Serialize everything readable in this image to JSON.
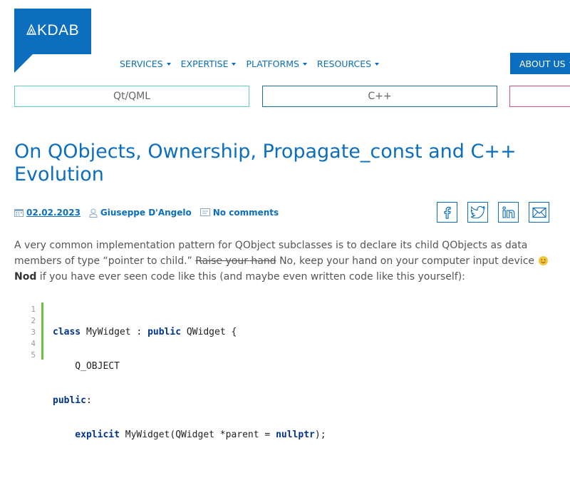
{
  "logo": {
    "text": "KDAB",
    "brand_color": "#0b6ebf"
  },
  "nav": {
    "items": [
      {
        "label": "SERVICES"
      },
      {
        "label": "EXPERTISE"
      },
      {
        "label": "PLATFORMS"
      },
      {
        "label": "RESOURCES"
      }
    ],
    "about_label": "ABOUT US"
  },
  "categories": [
    {
      "label": "Qt/QML",
      "color": "#5fd0c0"
    },
    {
      "label": "C++",
      "color": "#1e6f9f"
    },
    {
      "label": "",
      "color": "#d0507a"
    }
  ],
  "article": {
    "title": "On QObjects, Ownership, Propagate_const and C++ Evolution",
    "date": "02.02.2023",
    "author": "Giuseppe D'Angelo",
    "comments": "No comments",
    "share_icons": [
      "facebook-icon",
      "twitter-icon",
      "linkedin-icon",
      "email-icon"
    ],
    "paragraph": {
      "part1": "A very common implementation pattern for QObject subclasses is to declare its child QObjects as data members of type “pointer to child.” ",
      "strike": "Raise your hand",
      "part2": " No, keep your hand on your computer input device ",
      "bold": "Nod",
      "part3": " if you have ever seen code like this (and maybe even written code like this yourself):"
    }
  },
  "code": {
    "line_numbers": [
      "1",
      "2",
      "3",
      "4",
      "5"
    ],
    "lines": [
      {
        "kw": "class",
        "rest": " MyWidget : ",
        "kw2": "public",
        "rest2": " QWidget {"
      },
      {
        "kw": "",
        "rest": "    Q_OBJECT",
        "kw2": "",
        "rest2": ""
      },
      {
        "kw": "public",
        "rest": ":",
        "kw2": "",
        "rest2": ""
      },
      {
        "kw": "    explicit",
        "rest": " MyWidget(QWidget *parent = ",
        "kw2": "nullptr",
        "rest2": ");"
      },
      {
        "kw": "",
        "rest": "",
        "kw2": "",
        "rest2": ""
      }
    ]
  }
}
